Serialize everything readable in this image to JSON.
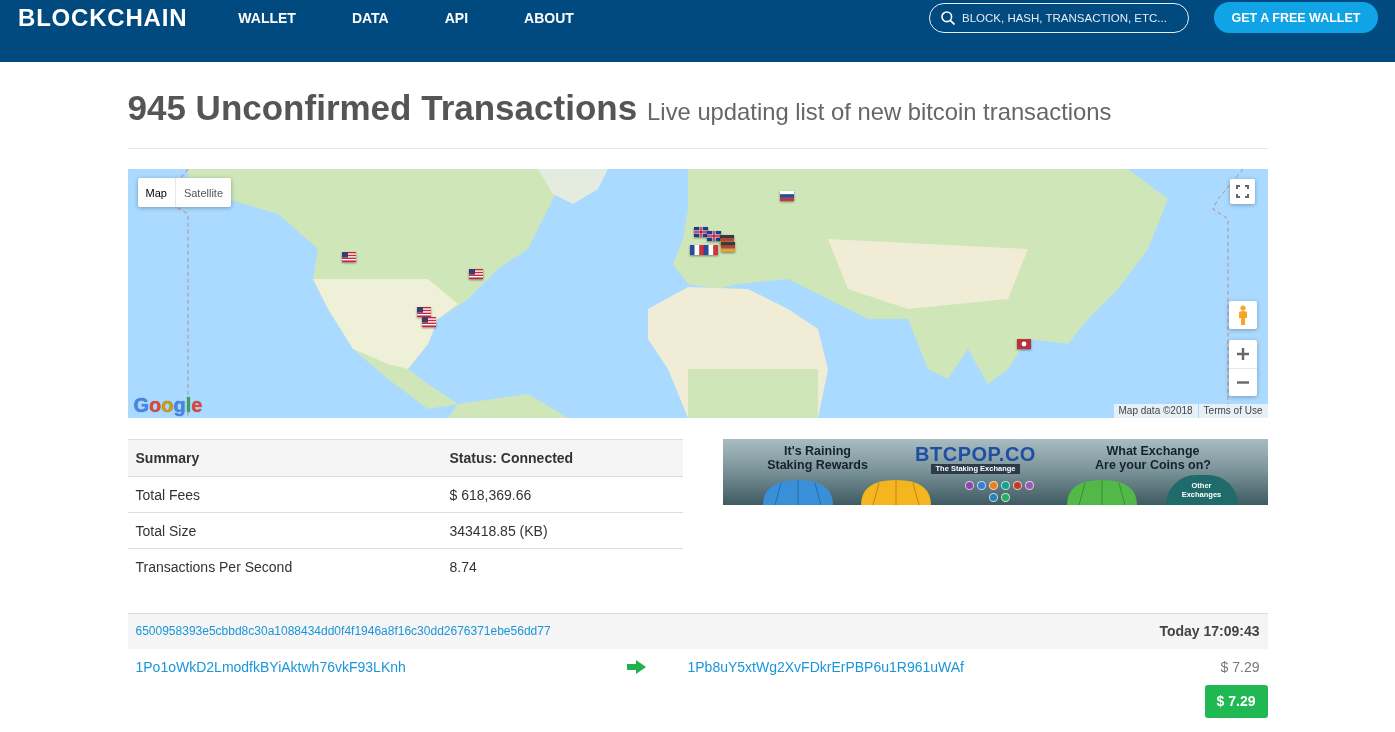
{
  "header": {
    "logo": "BLOCKCHAIN",
    "nav": [
      {
        "label": "WALLET"
      },
      {
        "label": "DATA"
      },
      {
        "label": "API"
      },
      {
        "label": "ABOUT"
      }
    ],
    "search": {
      "placeholder": "BLOCK, HASH, TRANSACTION, ETC..."
    },
    "cta": "GET A FREE WALLET"
  },
  "page": {
    "title": "945 Unconfirmed Transactions",
    "subtitle": "Live updating list of new bitcoin transactions"
  },
  "map": {
    "types": [
      {
        "label": "Map",
        "selected": true
      },
      {
        "label": "Satellite",
        "selected": false
      }
    ],
    "logo": "Google",
    "attribution": "Map data ©2018",
    "terms": "Terms of Use"
  },
  "summary": {
    "columns": [
      "Summary",
      "Status: Connected"
    ],
    "rows": [
      [
        "Total Fees",
        "$ 618,369.66"
      ],
      [
        "Total Size",
        "343418.85 (KB)"
      ],
      [
        "Transactions Per Second",
        "8.74"
      ]
    ]
  },
  "ad": {
    "left": [
      "It's Raining",
      "Staking Rewards"
    ],
    "brand": "BTCPOP.CO",
    "brand_tagline": "The Staking Exchange",
    "right": [
      "What Exchange",
      "Are your Coins on?"
    ],
    "umbrella_label": "Other Exchanges"
  },
  "transactions": [
    {
      "hash": "6500958393e5cbbd8c30a1088434dd0f4f1946a8f16c30dd2676371ebe56dd77",
      "time": "Today 17:09:43",
      "inputs": [
        "1Po1oWkD2LmodfkBYiAktwh76vkF93LKnh"
      ],
      "outputs": [
        {
          "address": "1Pb8uY5xtWg2XvFDkrErPBP6u1R961uWAf",
          "amount": "$ 7.29"
        }
      ],
      "total": "$ 7.29"
    }
  ]
}
